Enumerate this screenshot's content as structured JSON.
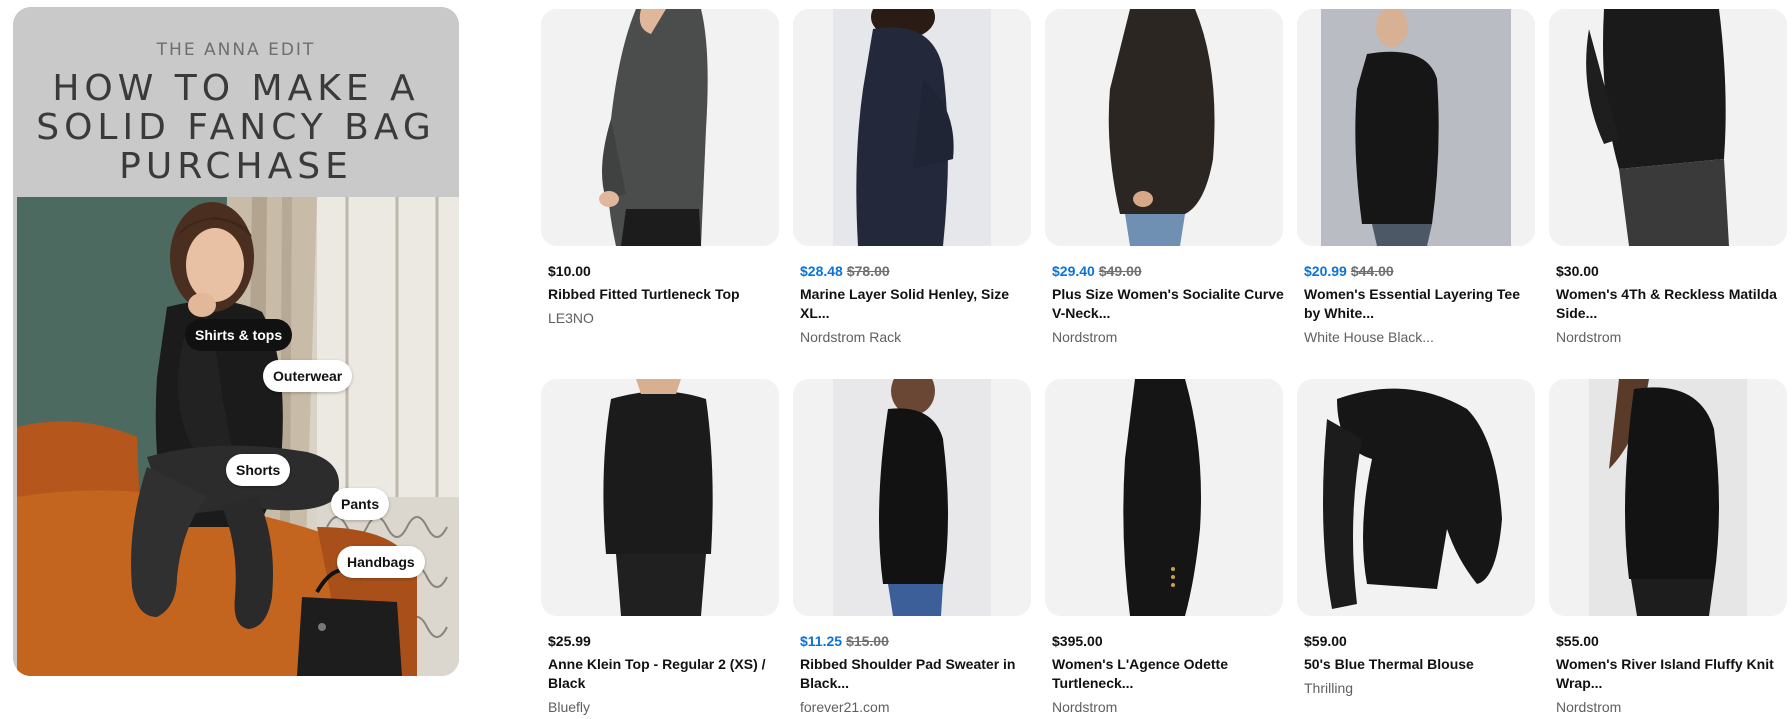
{
  "hero": {
    "kicker": "THE ANNA EDIT",
    "title_lines": [
      "HOW TO MAKE A",
      "SOLID FANCY BAG",
      "PURCHASE"
    ],
    "tags": [
      {
        "label": "Shirts & tops",
        "style": "dark"
      },
      {
        "label": "Outerwear",
        "style": "light"
      },
      {
        "label": "Shorts",
        "style": "light"
      },
      {
        "label": "Pants",
        "style": "light"
      },
      {
        "label": "Handbags",
        "style": "light"
      }
    ]
  },
  "colors": {
    "sale_price": "#0a73d9",
    "thumb_bg": "#f3f3f3",
    "hero_bg": "#c9c9c9"
  },
  "products": [
    {
      "price": "$10.00",
      "sale": false,
      "orig": "",
      "title": "Ribbed Fitted Turtleneck Top",
      "seller": "LE3NO"
    },
    {
      "price": "$28.48",
      "sale": true,
      "orig": "$78.00",
      "title": "Marine Layer Solid Henley, Size XL...",
      "seller": "Nordstrom Rack"
    },
    {
      "price": "$29.40",
      "sale": true,
      "orig": "$49.00",
      "title": "Plus Size Women's Socialite Curve V-Neck...",
      "seller": "Nordstrom"
    },
    {
      "price": "$20.99",
      "sale": true,
      "orig": "$44.00",
      "title": "Women's Essential Layering Tee by White...",
      "seller": "White House Black..."
    },
    {
      "price": "$30.00",
      "sale": false,
      "orig": "",
      "title": "Women's 4Th & Reckless Matilda Side...",
      "seller": "Nordstrom"
    },
    {
      "price": "$25.99",
      "sale": false,
      "orig": "",
      "title": "Anne Klein Top - Regular 2 (XS) / Black",
      "seller": "Bluefly"
    },
    {
      "price": "$11.25",
      "sale": true,
      "orig": "$15.00",
      "title": "Ribbed Shoulder Pad Sweater in Black...",
      "seller": "forever21.com"
    },
    {
      "price": "$395.00",
      "sale": false,
      "orig": "",
      "title": "Women's L'Agence Odette Turtleneck...",
      "seller": "Nordstrom"
    },
    {
      "price": "$59.00",
      "sale": false,
      "orig": "",
      "title": "50's Blue Thermal Blouse",
      "seller": "Thrilling"
    },
    {
      "price": "$55.00",
      "sale": false,
      "orig": "",
      "title": "Women's River Island Fluffy Knit Wrap...",
      "seller": "Nordstrom"
    }
  ]
}
